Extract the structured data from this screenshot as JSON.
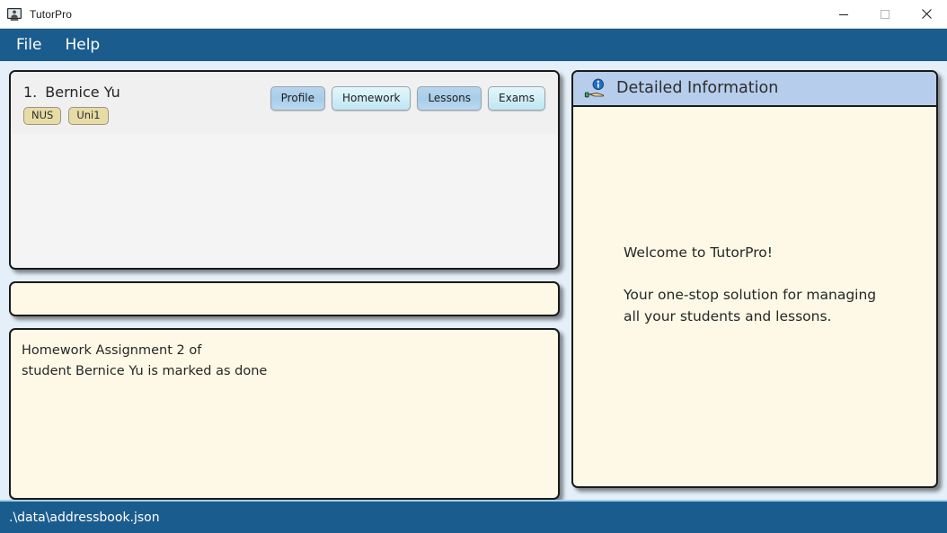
{
  "window": {
    "title": "TutorPro",
    "app_icon": "person-on-monitor-icon",
    "controls": {
      "minimize": "minimize-icon",
      "maximize": "maximize-icon",
      "close": "close-icon"
    }
  },
  "menubar": {
    "items": [
      {
        "label": "File"
      },
      {
        "label": "Help"
      }
    ]
  },
  "student_list": {
    "students": [
      {
        "index": "1.",
        "name": "Bernice Yu",
        "tags": [
          "NUS",
          "Uni1"
        ],
        "buttons": [
          {
            "label": "Profile",
            "shade": "dark"
          },
          {
            "label": "Homework",
            "shade": "light"
          },
          {
            "label": "Lessons",
            "shade": "dark"
          },
          {
            "label": "Exams",
            "shade": "light"
          }
        ]
      }
    ]
  },
  "command_box": {
    "value": "",
    "placeholder": ""
  },
  "result_box": {
    "text": "Homework Assignment 2 of\nstudent Bernice Yu is marked as done"
  },
  "detail_panel": {
    "icon": "hand-holding-info-icon",
    "title": "Detailed Information",
    "welcome_title": "Welcome to TutorPro!",
    "welcome_body": "Your one-stop solution for managing\nall your students and lessons."
  },
  "statusbar": {
    "path": ".\\data\\addressbook.json"
  },
  "colors": {
    "chrome_blue": "#1b5c8e",
    "page_background": "#e4eff9",
    "panel_cream": "#fdf9e6",
    "panel_gray": "#f0f0f0",
    "header_blue": "#b6cdec",
    "tag_khaki": "#e7dba6",
    "button_dark": "#a8cde9",
    "button_light": "#cfeef7"
  }
}
